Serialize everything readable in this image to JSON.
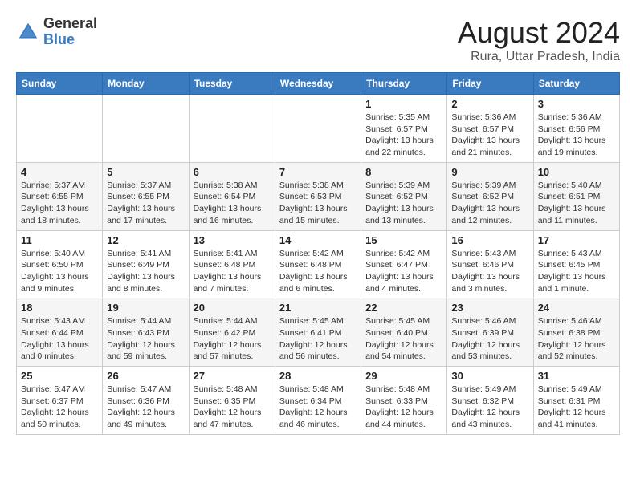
{
  "header": {
    "logo_general": "General",
    "logo_blue": "Blue",
    "month_year": "August 2024",
    "location": "Rura, Uttar Pradesh, India"
  },
  "weekdays": [
    "Sunday",
    "Monday",
    "Tuesday",
    "Wednesday",
    "Thursday",
    "Friday",
    "Saturday"
  ],
  "weeks": [
    [
      {
        "day": "",
        "info": ""
      },
      {
        "day": "",
        "info": ""
      },
      {
        "day": "",
        "info": ""
      },
      {
        "day": "",
        "info": ""
      },
      {
        "day": "1",
        "info": "Sunrise: 5:35 AM\nSunset: 6:57 PM\nDaylight: 13 hours\nand 22 minutes."
      },
      {
        "day": "2",
        "info": "Sunrise: 5:36 AM\nSunset: 6:57 PM\nDaylight: 13 hours\nand 21 minutes."
      },
      {
        "day": "3",
        "info": "Sunrise: 5:36 AM\nSunset: 6:56 PM\nDaylight: 13 hours\nand 19 minutes."
      }
    ],
    [
      {
        "day": "4",
        "info": "Sunrise: 5:37 AM\nSunset: 6:55 PM\nDaylight: 13 hours\nand 18 minutes."
      },
      {
        "day": "5",
        "info": "Sunrise: 5:37 AM\nSunset: 6:55 PM\nDaylight: 13 hours\nand 17 minutes."
      },
      {
        "day": "6",
        "info": "Sunrise: 5:38 AM\nSunset: 6:54 PM\nDaylight: 13 hours\nand 16 minutes."
      },
      {
        "day": "7",
        "info": "Sunrise: 5:38 AM\nSunset: 6:53 PM\nDaylight: 13 hours\nand 15 minutes."
      },
      {
        "day": "8",
        "info": "Sunrise: 5:39 AM\nSunset: 6:52 PM\nDaylight: 13 hours\nand 13 minutes."
      },
      {
        "day": "9",
        "info": "Sunrise: 5:39 AM\nSunset: 6:52 PM\nDaylight: 13 hours\nand 12 minutes."
      },
      {
        "day": "10",
        "info": "Sunrise: 5:40 AM\nSunset: 6:51 PM\nDaylight: 13 hours\nand 11 minutes."
      }
    ],
    [
      {
        "day": "11",
        "info": "Sunrise: 5:40 AM\nSunset: 6:50 PM\nDaylight: 13 hours\nand 9 minutes."
      },
      {
        "day": "12",
        "info": "Sunrise: 5:41 AM\nSunset: 6:49 PM\nDaylight: 13 hours\nand 8 minutes."
      },
      {
        "day": "13",
        "info": "Sunrise: 5:41 AM\nSunset: 6:48 PM\nDaylight: 13 hours\nand 7 minutes."
      },
      {
        "day": "14",
        "info": "Sunrise: 5:42 AM\nSunset: 6:48 PM\nDaylight: 13 hours\nand 6 minutes."
      },
      {
        "day": "15",
        "info": "Sunrise: 5:42 AM\nSunset: 6:47 PM\nDaylight: 13 hours\nand 4 minutes."
      },
      {
        "day": "16",
        "info": "Sunrise: 5:43 AM\nSunset: 6:46 PM\nDaylight: 13 hours\nand 3 minutes."
      },
      {
        "day": "17",
        "info": "Sunrise: 5:43 AM\nSunset: 6:45 PM\nDaylight: 13 hours\nand 1 minute."
      }
    ],
    [
      {
        "day": "18",
        "info": "Sunrise: 5:43 AM\nSunset: 6:44 PM\nDaylight: 13 hours\nand 0 minutes."
      },
      {
        "day": "19",
        "info": "Sunrise: 5:44 AM\nSunset: 6:43 PM\nDaylight: 12 hours\nand 59 minutes."
      },
      {
        "day": "20",
        "info": "Sunrise: 5:44 AM\nSunset: 6:42 PM\nDaylight: 12 hours\nand 57 minutes."
      },
      {
        "day": "21",
        "info": "Sunrise: 5:45 AM\nSunset: 6:41 PM\nDaylight: 12 hours\nand 56 minutes."
      },
      {
        "day": "22",
        "info": "Sunrise: 5:45 AM\nSunset: 6:40 PM\nDaylight: 12 hours\nand 54 minutes."
      },
      {
        "day": "23",
        "info": "Sunrise: 5:46 AM\nSunset: 6:39 PM\nDaylight: 12 hours\nand 53 minutes."
      },
      {
        "day": "24",
        "info": "Sunrise: 5:46 AM\nSunset: 6:38 PM\nDaylight: 12 hours\nand 52 minutes."
      }
    ],
    [
      {
        "day": "25",
        "info": "Sunrise: 5:47 AM\nSunset: 6:37 PM\nDaylight: 12 hours\nand 50 minutes."
      },
      {
        "day": "26",
        "info": "Sunrise: 5:47 AM\nSunset: 6:36 PM\nDaylight: 12 hours\nand 49 minutes."
      },
      {
        "day": "27",
        "info": "Sunrise: 5:48 AM\nSunset: 6:35 PM\nDaylight: 12 hours\nand 47 minutes."
      },
      {
        "day": "28",
        "info": "Sunrise: 5:48 AM\nSunset: 6:34 PM\nDaylight: 12 hours\nand 46 minutes."
      },
      {
        "day": "29",
        "info": "Sunrise: 5:48 AM\nSunset: 6:33 PM\nDaylight: 12 hours\nand 44 minutes."
      },
      {
        "day": "30",
        "info": "Sunrise: 5:49 AM\nSunset: 6:32 PM\nDaylight: 12 hours\nand 43 minutes."
      },
      {
        "day": "31",
        "info": "Sunrise: 5:49 AM\nSunset: 6:31 PM\nDaylight: 12 hours\nand 41 minutes."
      }
    ]
  ]
}
